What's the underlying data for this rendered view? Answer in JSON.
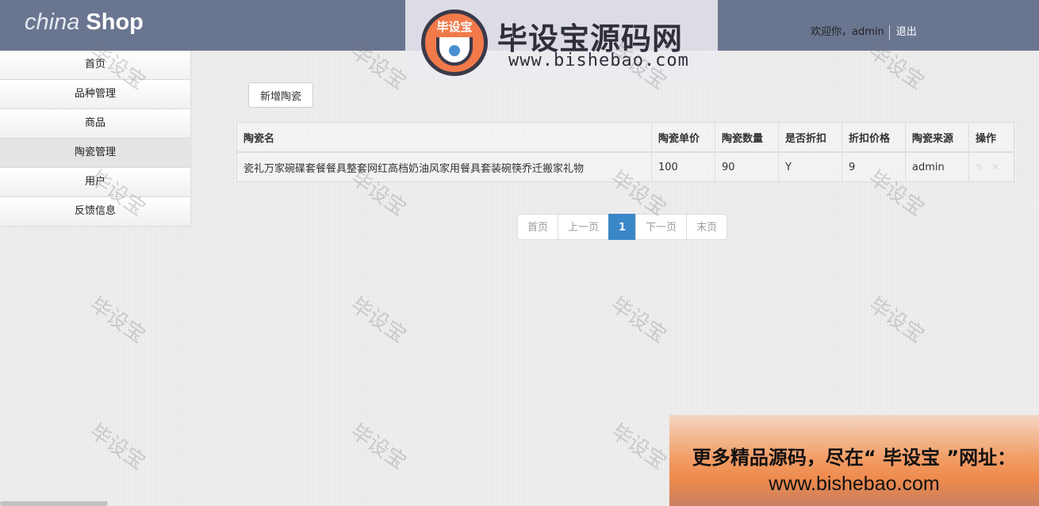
{
  "header": {
    "brand_italic": "china",
    "brand_bold": "Shop",
    "welcome": "欢迎你，admin",
    "logout": "退出"
  },
  "logo": {
    "badge_text": "毕设宝",
    "title": "毕设宝源码网",
    "url": "www.bishebao.com"
  },
  "sidebar": {
    "items": [
      {
        "label": "首页"
      },
      {
        "label": "品种管理"
      },
      {
        "label": "商品"
      },
      {
        "label": "陶瓷管理"
      },
      {
        "label": "用户"
      },
      {
        "label": "反馈信息"
      }
    ]
  },
  "toolbar": {
    "add_label": "新增陶瓷"
  },
  "table": {
    "headers": [
      "陶瓷名",
      "陶瓷单价",
      "陶瓷数量",
      "是否折扣",
      "折扣价格",
      "陶瓷来源",
      "操作"
    ],
    "rows": [
      [
        "瓷礼万家碗碟套餐餐具整套网红高档奶油风家用餐具套装碗筷乔迁搬家礼物",
        "100",
        "90",
        "Y",
        "9",
        "admin"
      ]
    ],
    "op_icons": [
      "edit-icon",
      "delete-icon"
    ]
  },
  "pagination": {
    "first": "首页",
    "prev": "上一页",
    "current": "1",
    "next": "下一页",
    "last": "末页"
  },
  "watermark": {
    "text": "毕设宝"
  },
  "promo": {
    "line1": "更多精品源码，尽在“ 毕设宝 ”网址：",
    "line2": "www.bishebao.com"
  },
  "colors": {
    "header_bg": "#6a7590",
    "active_page": "#3a87c8",
    "promo_orange": "#ee8a4c"
  }
}
